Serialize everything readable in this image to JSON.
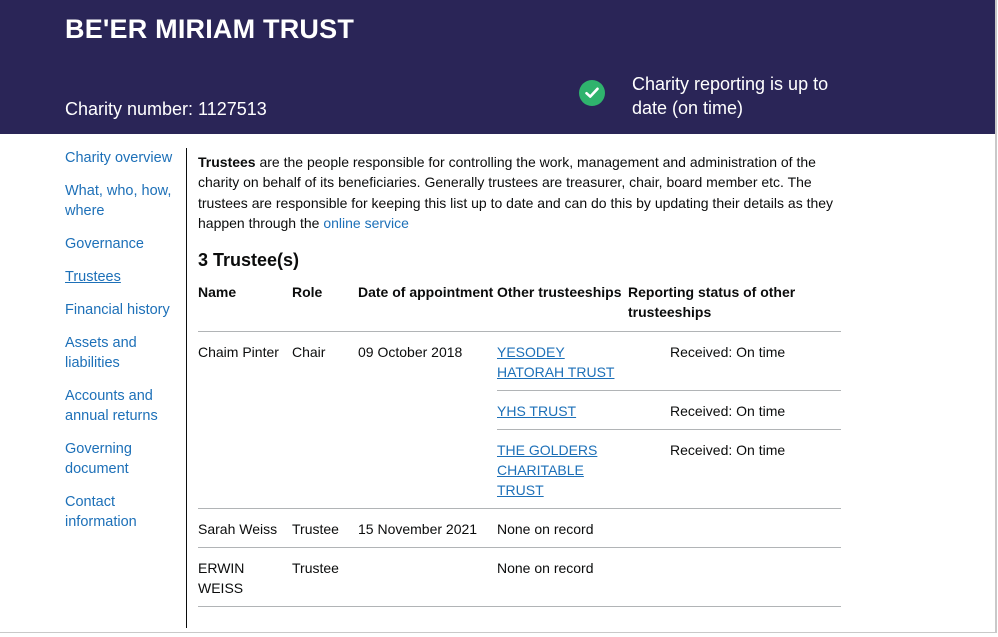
{
  "header": {
    "title": "BE'ER MIRIAM TRUST",
    "charity_number": "Charity number: 1127513",
    "status_text": "Charity reporting is up to date (on time)",
    "status_color": "#2fb36d",
    "background": "#2a2557"
  },
  "sidebar": {
    "items": [
      {
        "label": "Charity overview"
      },
      {
        "label": "What, who, how, where"
      },
      {
        "label": "Governance"
      },
      {
        "label": "Trustees"
      },
      {
        "label": "Financial history"
      },
      {
        "label": "Assets and liabilities"
      },
      {
        "label": "Accounts and annual returns"
      },
      {
        "label": "Governing document"
      },
      {
        "label": "Contact information"
      }
    ]
  },
  "intro": {
    "bold": "Trustees",
    "text": " are the people responsible for controlling the work, management and administration of the charity on behalf of its beneficiaries. Generally trustees are treasurer, chair, board member etc. The trustees are responsible for keeping this list up to date and can do this by updating their details as they happen through the ",
    "link": "online service"
  },
  "trustees": {
    "heading": "3 Trustee(s)",
    "columns": [
      "Name",
      "Role",
      "Date of appointment",
      "Other trusteeships",
      "Reporting status of other trusteeships"
    ],
    "rows": [
      {
        "name": "Chaim Pinter",
        "role": "Chair",
        "date": "09 October 2018",
        "others": [
          {
            "trust": "YESODEY HATORAH TRUST",
            "status": "Received: On time"
          },
          {
            "trust": "YHS TRUST",
            "status": "Received: On time"
          },
          {
            "trust": "THE GOLDERS CHARITABLE TRUST",
            "status": "Received: On time"
          }
        ]
      },
      {
        "name": "Sarah Weiss",
        "role": "Trustee",
        "date": "15 November 2021",
        "none": "None on record"
      },
      {
        "name": "ERWIN WEISS",
        "role": "Trustee",
        "date": "",
        "none": "None on record"
      }
    ]
  }
}
